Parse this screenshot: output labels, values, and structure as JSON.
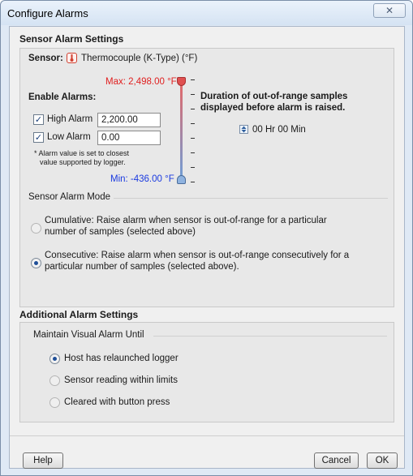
{
  "window": {
    "title": "Configure Alarms",
    "close_glyph": "✕"
  },
  "sensor_section": {
    "title": "Sensor Alarm Settings",
    "sensor_label": "Sensor:",
    "sensor_icon": "thermometer-icon",
    "sensor_name": "Thermocouple (K-Type) (°F)",
    "max_label": "Max: 2,498.00 °F",
    "min_label": "Min: -436.00 °F",
    "enable_label": "Enable Alarms:",
    "high_alarm": {
      "label": "High Alarm",
      "checked": true,
      "value": "2,200.00"
    },
    "low_alarm": {
      "label": "Low Alarm",
      "checked": true,
      "value": "0.00"
    },
    "note_line1": "* Alarm value is set to closest",
    "note_line2": "value supported by logger.",
    "duration_line1": "Duration of out-of-range samples",
    "duration_line2": "displayed before alarm is raised.",
    "duration_value": "00 Hr 00 Min",
    "colors": {
      "max": "#e02020",
      "min": "#1a3ae0"
    }
  },
  "alarm_mode": {
    "title": "Sensor Alarm Mode",
    "options": [
      {
        "line1": "Cumulative: Raise alarm when sensor is out-of-range for a particular",
        "line2": "number of samples (selected above)",
        "selected": false
      },
      {
        "line1": "Consecutive: Raise alarm when sensor is out-of-range consecutively for a",
        "line2": "particular number of samples (selected above).",
        "selected": true
      }
    ]
  },
  "additional": {
    "title": "Additional Alarm Settings",
    "group_title": "Maintain Visual Alarm Until",
    "options": [
      {
        "label": "Host has relaunched logger",
        "selected": true
      },
      {
        "label": "Sensor reading within limits",
        "selected": false
      },
      {
        "label": "Cleared with button press",
        "selected": false
      }
    ]
  },
  "footer": {
    "help": "Help",
    "cancel": "Cancel",
    "ok": "OK"
  }
}
